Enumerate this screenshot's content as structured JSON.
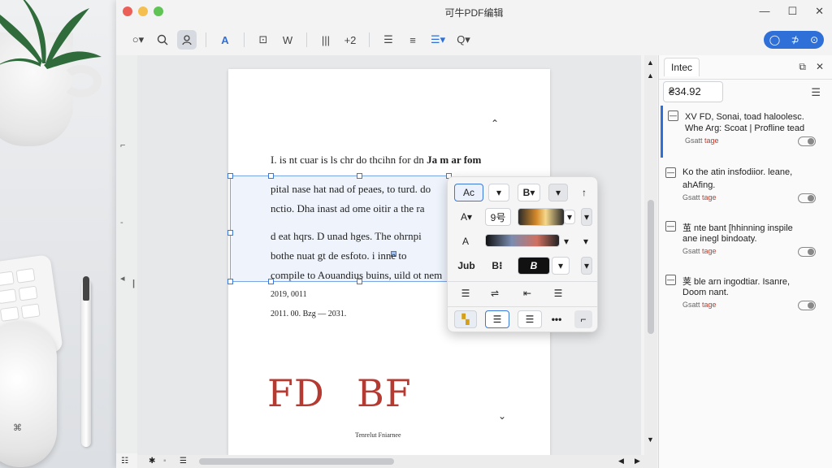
{
  "window": {
    "title": "可牛PDF编辑",
    "controls": {
      "minimize": "—",
      "maximize": "☐",
      "close": "✕"
    }
  },
  "toolbar": {
    "items": [
      {
        "name": "lasso-tool",
        "label": "○▾"
      },
      {
        "name": "zoom-tool",
        "label": "🔍"
      },
      {
        "name": "hand-tool",
        "label": "⚲"
      },
      {
        "name": "text-tool",
        "label": "A"
      },
      {
        "name": "edit-object-tool",
        "label": "⊡"
      },
      {
        "name": "watermark-tool",
        "label": "W"
      },
      {
        "name": "columns-tool",
        "label": "|||"
      },
      {
        "name": "insert-tool",
        "label": "+2"
      },
      {
        "name": "bullet-list-tool",
        "label": "☰"
      },
      {
        "name": "align-tool",
        "label": "≡"
      },
      {
        "name": "list-dropdown-tool",
        "label": "☰▾"
      },
      {
        "name": "find-tool",
        "label": "Q▾"
      }
    ],
    "pill": {
      "a": "◯",
      "b": "⊅",
      "c": "⊙"
    }
  },
  "document": {
    "heading_plain": "I. is nt cuar is ls chr do thcihn for dn ",
    "heading_bold": "Ja m ar fom",
    "lines": [
      "pital nase hat nad of peaes, to turd. do",
      "nctio. Dha inast ad ome oitir a the ra",
      "d eat hqrs. D unad hges. The ohrnpi",
      "bothe nuat gt de esfoto. i inne to",
      "compile to Aouandius buins, uild ot nem"
    ],
    "date_line1": "2019, 0011",
    "date_line2": "2011. 00. Bzg    —  2031.",
    "signature_left": "FD",
    "signature_right": "BF",
    "signature_caption": "Tenrelut Fniarnee"
  },
  "format_panel": {
    "font_style": "Ac",
    "bold_menu": "B",
    "size_label": "A",
    "size_value": "9号",
    "color_label": "A",
    "sub_label": "Jub",
    "bold_b": "B",
    "bold_b2": "B"
  },
  "sidebar": {
    "tab": "Intec",
    "search_value": "₴34.92",
    "comments": [
      {
        "line1": "XV FD, Sonai, toad haloolesc.",
        "line2": "Whe Arg: Scoat | Profline tead",
        "author": "Gsatt",
        "tag": "tage"
      },
      {
        "line1": "Ko the atin insfodiior. leane,",
        "line2": "ahAfing.",
        "author": "Gsatt",
        "tag": "tage"
      },
      {
        "line1": "茧 nte bant [hhinning inspile",
        "line2": "ane inegl bindoaty.",
        "author": "Gsatt",
        "tag": "tage"
      },
      {
        "line1": "荚 ble arn ingodtiar. Isanre,",
        "line2": "Doom nant.",
        "author": "Gsatt",
        "tag": "tage"
      }
    ]
  },
  "statusbar": {
    "icons": [
      "☷",
      "✱",
      "▪",
      "☰"
    ]
  },
  "colors": {
    "accent": "#2f6fd8",
    "signature": "#b43a32"
  }
}
